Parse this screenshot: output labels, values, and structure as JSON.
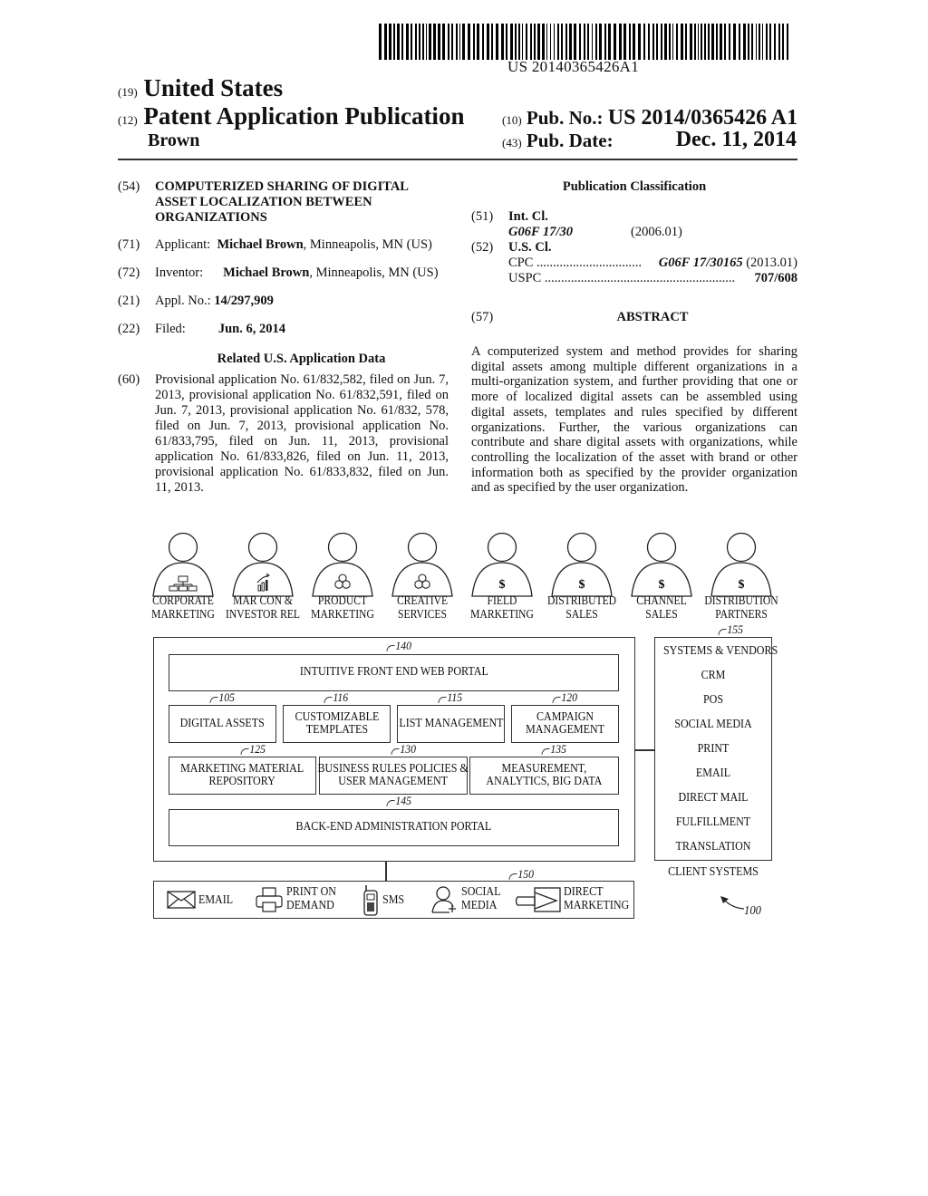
{
  "barcode_text": "US 20140365426A1",
  "header": {
    "country_code": "(19)",
    "country": "United States",
    "type_code": "(12)",
    "type": "Patent Application Publication",
    "author": "Brown",
    "pub_no_code": "(10)",
    "pub_no_label": "Pub. No.:",
    "pub_no": "US 2014/0365426 A1",
    "pub_date_code": "(43)",
    "pub_date_label": "Pub. Date:",
    "pub_date": "Dec. 11, 2014"
  },
  "biblio": {
    "title_code": "(54)",
    "title_lines": [
      "COMPUTERIZED SHARING OF DIGITAL",
      "ASSET LOCALIZATION BETWEEN",
      "ORGANIZATIONS"
    ],
    "applicant_code": "(71)",
    "applicant_label": "Applicant:",
    "applicant_name": "Michael Brown",
    "applicant_loc": ", Minneapolis, MN (US)",
    "inventor_code": "(72)",
    "inventor_label": "Inventor:",
    "inventor_name": "Michael Brown",
    "inventor_loc": ", Minneapolis, MN (US)",
    "appl_code": "(21)",
    "appl_label": "Appl. No.:",
    "appl_no": "14/297,909",
    "filed_code": "(22)",
    "filed_label": "Filed:",
    "filed_date": "Jun. 6, 2014",
    "related_heading": "Related U.S. Application Data",
    "related_code": "(60)",
    "related_text": "Provisional application No. 61/832,582, filed on Jun. 7, 2013, provisional application No. 61/832,591, filed on Jun. 7, 2013, provisional application No. 61/832, 578, filed on Jun. 7, 2013, provisional application No. 61/833,795, filed on Jun. 11, 2013, provisional application No. 61/833,826, filed on Jun. 11, 2013, provisional application No. 61/833,832, filed on Jun. 11, 2013."
  },
  "classification": {
    "heading": "Publication Classification",
    "int_code": "(51)",
    "int_label": "Int. Cl.",
    "int_class": "G06F 17/30",
    "int_version": "(2006.01)",
    "us_code": "(52)",
    "us_label": "U.S. Cl.",
    "cpc_label": "CPC",
    "cpc_dots": "................................",
    "cpc_class": "G06F 17/30165",
    "cpc_version": "(2013.01)",
    "uspc_label": "USPC",
    "uspc_dots": "..........................................................",
    "uspc_class": "707/608"
  },
  "abstract": {
    "code": "(57)",
    "heading": "ABSTRACT",
    "text": "A computerized system and method provides for sharing digital assets among multiple different organizations in a multi-organization system, and further providing that one or more of localized digital assets can be assembled using digital assets, templates and rules specified by different organizations. Further, the various organizations can contribute and share digital assets with organizations, while controlling the localization of the asset with brand or other information both as specified by the provider organization and as specified by the user organization."
  },
  "figure": {
    "users": [
      {
        "line1": "CORPORATE",
        "line2": "MARKETING",
        "icon": "org-chart-icon"
      },
      {
        "line1": "MAR CON &",
        "line2": "INVESTOR REL",
        "icon": "growth-chart-icon"
      },
      {
        "line1": "PRODUCT",
        "line2": "MARKETING",
        "icon": "circles-icon"
      },
      {
        "line1": "CREATIVE",
        "line2": "SERVICES",
        "icon": "circles-icon"
      },
      {
        "line1": "FIELD",
        "line2": "MARKETING",
        "icon": "dollar-icon",
        "glyph": "$"
      },
      {
        "line1": "DISTRIBUTED",
        "line2": "SALES",
        "icon": "dollar-icon",
        "glyph": "$"
      },
      {
        "line1": "CHANNEL",
        "line2": "SALES",
        "icon": "dollar-icon",
        "glyph": "$"
      },
      {
        "line1": "DISTRIBUTION",
        "line2": "PARTNERS",
        "icon": "dollar-icon",
        "glyph": "$"
      }
    ],
    "portal": {
      "ref": "140",
      "label": "INTUITIVE FRONT END WEB PORTAL"
    },
    "row1": [
      {
        "ref": "105",
        "line1": "DIGITAL ASSETS",
        "line2": ""
      },
      {
        "ref": "116",
        "line1": "CUSTOMIZABLE",
        "line2": "TEMPLATES"
      },
      {
        "ref": "115",
        "line1": "LIST MANAGEMENT",
        "line2": ""
      },
      {
        "ref": "120",
        "line1": "CAMPAIGN",
        "line2": "MANAGEMENT"
      }
    ],
    "row2": [
      {
        "ref": "125",
        "line1": "MARKETING MATERIAL",
        "line2": "REPOSITORY"
      },
      {
        "ref": "130",
        "line1": "BUSINESS RULES POLICIES &",
        "line2": "USER MANAGEMENT"
      },
      {
        "ref": "135",
        "line1": "MEASUREMENT,",
        "line2": "ANALYTICS, BIG  DATA"
      }
    ],
    "backend": {
      "ref": "145",
      "label": "BACK-END ADMINISTRATION PORTAL"
    },
    "systems": {
      "ref": "155",
      "items": [
        "SYSTEMS & VENDORS",
        "CRM",
        "POS",
        "SOCIAL MEDIA",
        "PRINT",
        "EMAIL",
        "DIRECT MAIL",
        "FULFILLMENT",
        "TRANSLATION"
      ],
      "caption": "CLIENT SYSTEMS"
    },
    "channels": {
      "ref": "150",
      "items": [
        {
          "line1": "EMAIL",
          "line2": "",
          "icon": "envelope-icon"
        },
        {
          "line1": "PRINT ON",
          "line2": "DEMAND",
          "icon": "printer-icon"
        },
        {
          "line1": "SMS",
          "line2": "",
          "icon": "mobile-phone-icon"
        },
        {
          "line1": "SOCIAL",
          "line2": "MEDIA",
          "icon": "person-add-icon"
        },
        {
          "line1": "DIRECT",
          "line2": "MARKETING",
          "icon": "direct-arrow-icon"
        }
      ]
    },
    "figure_ref": "100"
  }
}
